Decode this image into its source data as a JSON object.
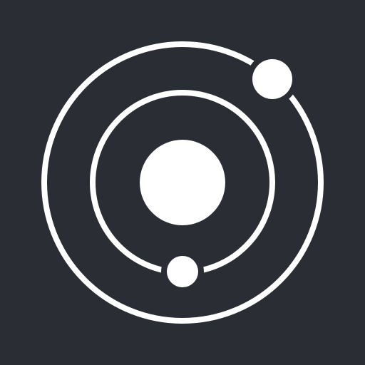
{
  "icon": {
    "name": "orbit-icon",
    "description_free": true,
    "colors": {
      "background": "#2a2d33",
      "foreground": "#ffffff"
    }
  }
}
